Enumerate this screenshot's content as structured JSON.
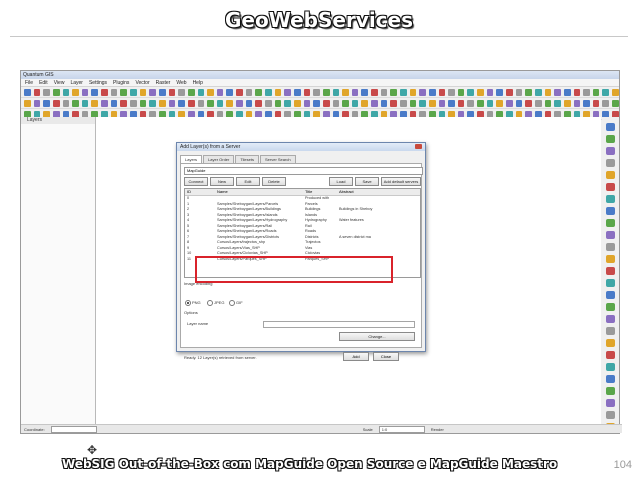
{
  "slide": {
    "title": "GeoWebServices",
    "footer": "WebSIG Out-of-the-Box com MapGuide Open Source e MapGuide Maestro",
    "page_number": "104"
  },
  "app": {
    "title": "Quantum GIS",
    "menu": [
      "File",
      "Edit",
      "View",
      "Layer",
      "Settings",
      "Plugins",
      "Vector",
      "Raster",
      "Web",
      "Help"
    ],
    "layers_header": "Layers",
    "north_arrow": "✥",
    "status": {
      "coordinate_label": "Coordinate:",
      "scale_label": "Scale",
      "scale_value": "1:0",
      "render_label": "Render"
    }
  },
  "dialog": {
    "title": "Add Layer(s) from a Server",
    "tabs": [
      "Layers",
      "Layer Order",
      "Tilesets",
      "Server Search"
    ],
    "server_select": "MapGuide",
    "buttons": {
      "connect": "Connect",
      "new": "New",
      "edit": "Edit",
      "delete": "Delete",
      "load": "Load",
      "save": "Save",
      "add_default": "Add default servers"
    },
    "columns": [
      "ID",
      "Name",
      "Title",
      "Abstract"
    ],
    "rows": [
      {
        "id": "0",
        "name": "",
        "title": "Produced with",
        "abstract": ""
      },
      {
        "id": "1",
        "name": "Samples/Sheboygan/Layers/Parcels",
        "title": "Parcels",
        "abstract": ""
      },
      {
        "id": "2",
        "name": "Samples/Sheboygan/Layers/Buildings",
        "title": "Buildings",
        "abstract": "Buildings in Sheboy"
      },
      {
        "id": "3",
        "name": "Samples/Sheboygan/Layers/Islands",
        "title": "Islands",
        "abstract": ""
      },
      {
        "id": "4",
        "name": "Samples/Sheboygan/Layers/Hydrography",
        "title": "Hydrography",
        "abstract": "Water features"
      },
      {
        "id": "5",
        "name": "Samples/Sheboygan/Layers/Rail",
        "title": "Rail",
        "abstract": ""
      },
      {
        "id": "6",
        "name": "Samples/Sheboygan/Layers/Roads",
        "title": "Roads",
        "abstract": ""
      },
      {
        "id": "7",
        "name": "Samples/Sheboygan/Layers/Districts",
        "title": "Districts",
        "abstract": "A seven district ma"
      },
      {
        "id": "8",
        "name": "Cursos/Layers/trajectos_shp",
        "title": "Trajectos",
        "abstract": ""
      },
      {
        "id": "9",
        "name": "Cursos/Layers/Vias_SHP",
        "title": "Vias",
        "abstract": ""
      },
      {
        "id": "10",
        "name": "Cursos/Layers/Ciclovias_SHP",
        "title": "Ciclovias",
        "abstract": ""
      },
      {
        "id": "11",
        "name": "Cursos/Layers/Parques_SHP",
        "title": "Parques_SHP",
        "abstract": ""
      }
    ],
    "image_encoding_label": "Image encoding",
    "encodings": [
      "PNG",
      "JPEG",
      "GIF"
    ],
    "options_label": "Options",
    "layer_name_label": "Layer name",
    "change_button": "Change...",
    "footer_text": "Ready. 12 Layer(s) retrieved from server.",
    "add_button": "Add",
    "close_button": "Close"
  }
}
